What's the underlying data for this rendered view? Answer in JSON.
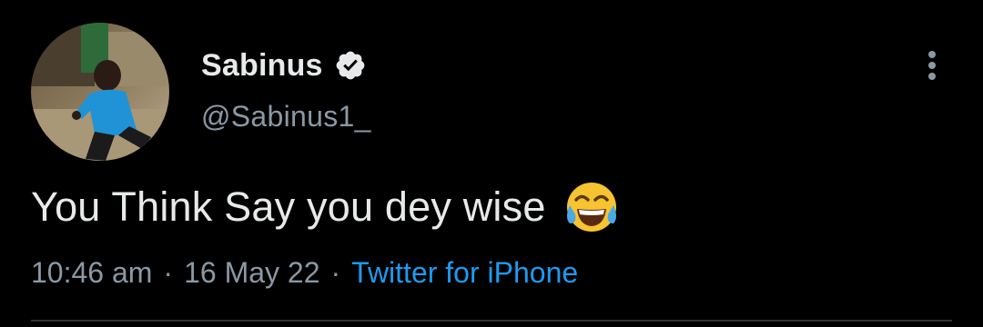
{
  "author": {
    "display_name": "Sabinus",
    "handle": "@Sabinus1_",
    "avatar_icon": "profile-photo",
    "verified_icon": "verified-badge-icon"
  },
  "tweet": {
    "text": "You Think Say you dey wise",
    "emoji_icon": "face-with-tears-of-joy-emoji"
  },
  "meta": {
    "time": "10:46 am",
    "separator": "·",
    "date": "16 May 22",
    "source": "Twitter for iPhone"
  },
  "colors": {
    "background": "#000000",
    "primary_text": "#e7e9ea",
    "secondary_text": "#8b98a5",
    "link": "#1d9bf0",
    "divider": "#2f3336"
  }
}
